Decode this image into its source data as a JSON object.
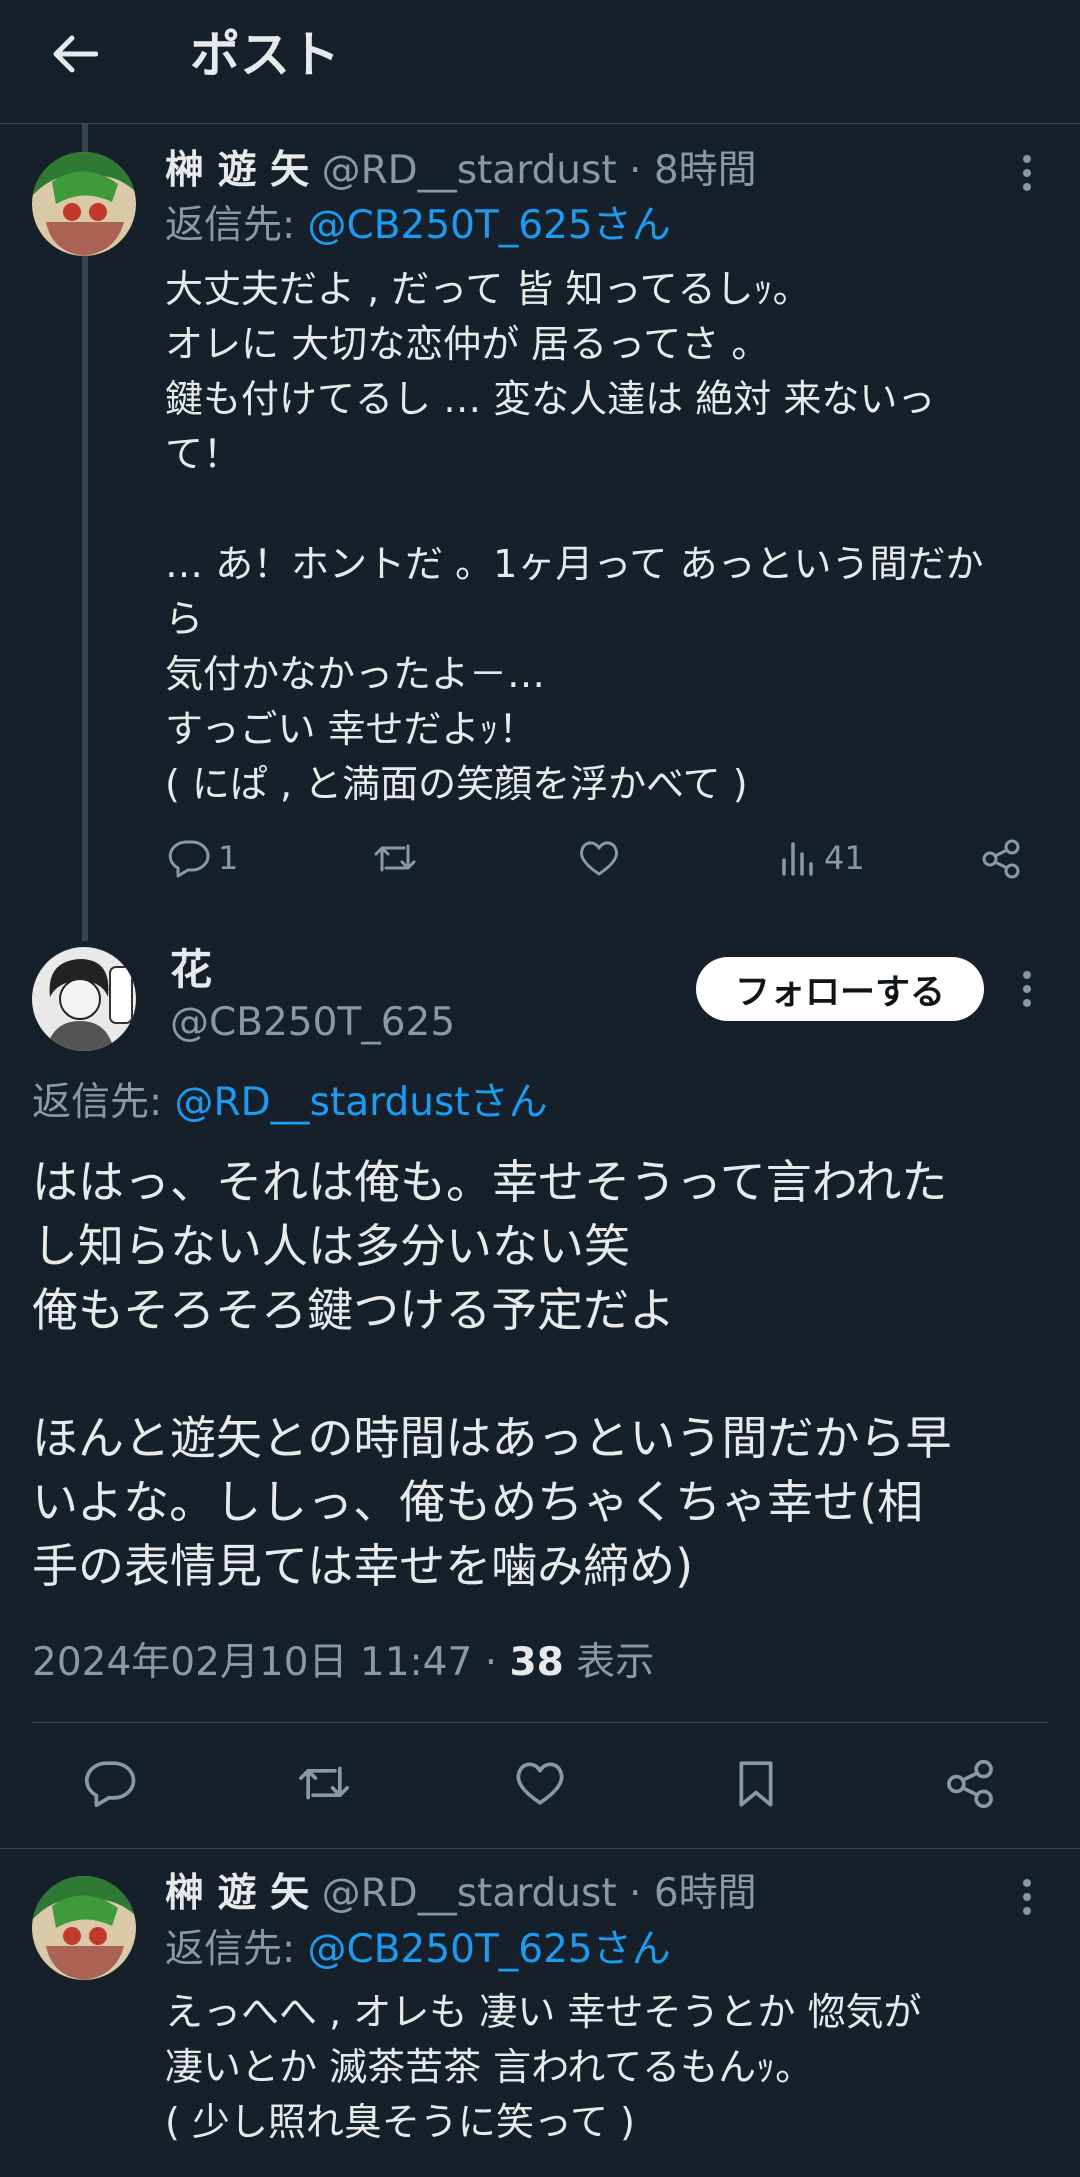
{
  "header": {
    "title": "ポスト"
  },
  "tweet1": {
    "display_name": "榊 遊 矢",
    "handle": "@RD__stardust",
    "time": "· 8時間",
    "reply_prefix": "返信先: ",
    "reply_handle": "@CB250T_625さん",
    "text": "大丈夫だよ , だって 皆 知ってるしｯ。\nオレに 大切な恋仲が 居るってさ 。\n鍵も付けてるし … 変な人達は 絶対 来ないっ\nて！\n\n… あ！ホントだ 。1ヶ月って あっという間だか\nら\n気付かなかったよ－…\nすっごい 幸せだよｯ！\n( にぱ , と満面の笑顔を浮かべて )",
    "replies": "1",
    "views": "41"
  },
  "main_tweet": {
    "display_name": "花",
    "handle": "@CB250T_625",
    "follow_label": "フォローする",
    "reply_prefix": "返信先: ",
    "reply_handle": "@RD__stardustさん",
    "text": "ははっ、それは俺も。幸せそうって言われた\nし知らない人は多分いない笑\n俺もそろそろ鍵つける予定だよ\n\nほんと遊矢との時間はあっという間だから早\nいよな。ししっ、俺もめちゃくちゃ幸せ(相\n手の表情見ては幸せを噛み締め)",
    "datetime": "2024年02月10日 11:47 · ",
    "view_count": "38",
    "view_label": " 表示"
  },
  "tweet3": {
    "display_name": "榊 遊 矢",
    "handle": "@RD__stardust",
    "time": "· 6時間",
    "reply_prefix": "返信先: ",
    "reply_handle": "@CB250T_625さん",
    "text": "えっへへ , オレも 凄い 幸せそうとか 惚気が\n凄いとか 滅茶苦茶 言われてるもんｯ。\n( 少し照れ臭そうに笑って )"
  },
  "icons": [
    "back-arrow-icon",
    "more-icon",
    "reply-icon",
    "retweet-icon",
    "like-icon",
    "views-icon",
    "share-icon",
    "bookmark-icon"
  ],
  "colors": {
    "background": "#15202b",
    "text": "#e7e9ea",
    "muted": "#8b98a5",
    "link": "#1d9bf0",
    "divider": "#38444d"
  }
}
